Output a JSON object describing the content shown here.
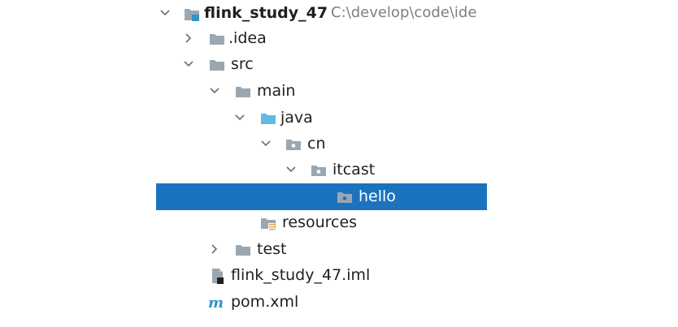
{
  "project_tree": {
    "root": {
      "label": "flink_study_47",
      "path": "C:\\develop\\code\\ide"
    },
    "items": [
      {
        "label": ".idea"
      },
      {
        "label": "src"
      },
      {
        "label": "main"
      },
      {
        "label": "java"
      },
      {
        "label": "cn"
      },
      {
        "label": "itcast"
      },
      {
        "label": "hello"
      },
      {
        "label": "resources"
      },
      {
        "label": "test"
      },
      {
        "label": "flink_study_47.iml"
      },
      {
        "label": "pom.xml"
      }
    ]
  },
  "icons": {
    "root": "module-folder-icon",
    "idea": "folder-icon",
    "src": "folder-icon",
    "main": "folder-icon",
    "java": "source-root-folder-icon",
    "cn": "package-icon",
    "itcast": "package-icon",
    "hello": "package-icon",
    "resources": "resources-folder-icon",
    "test": "folder-icon",
    "iml": "iml-file-icon",
    "pom": "maven-pom-icon"
  },
  "colors": {
    "selection": "#1b73c0",
    "folder": "#9aa7b0",
    "source_folder": "#62b9e3",
    "path_text": "#808080"
  }
}
